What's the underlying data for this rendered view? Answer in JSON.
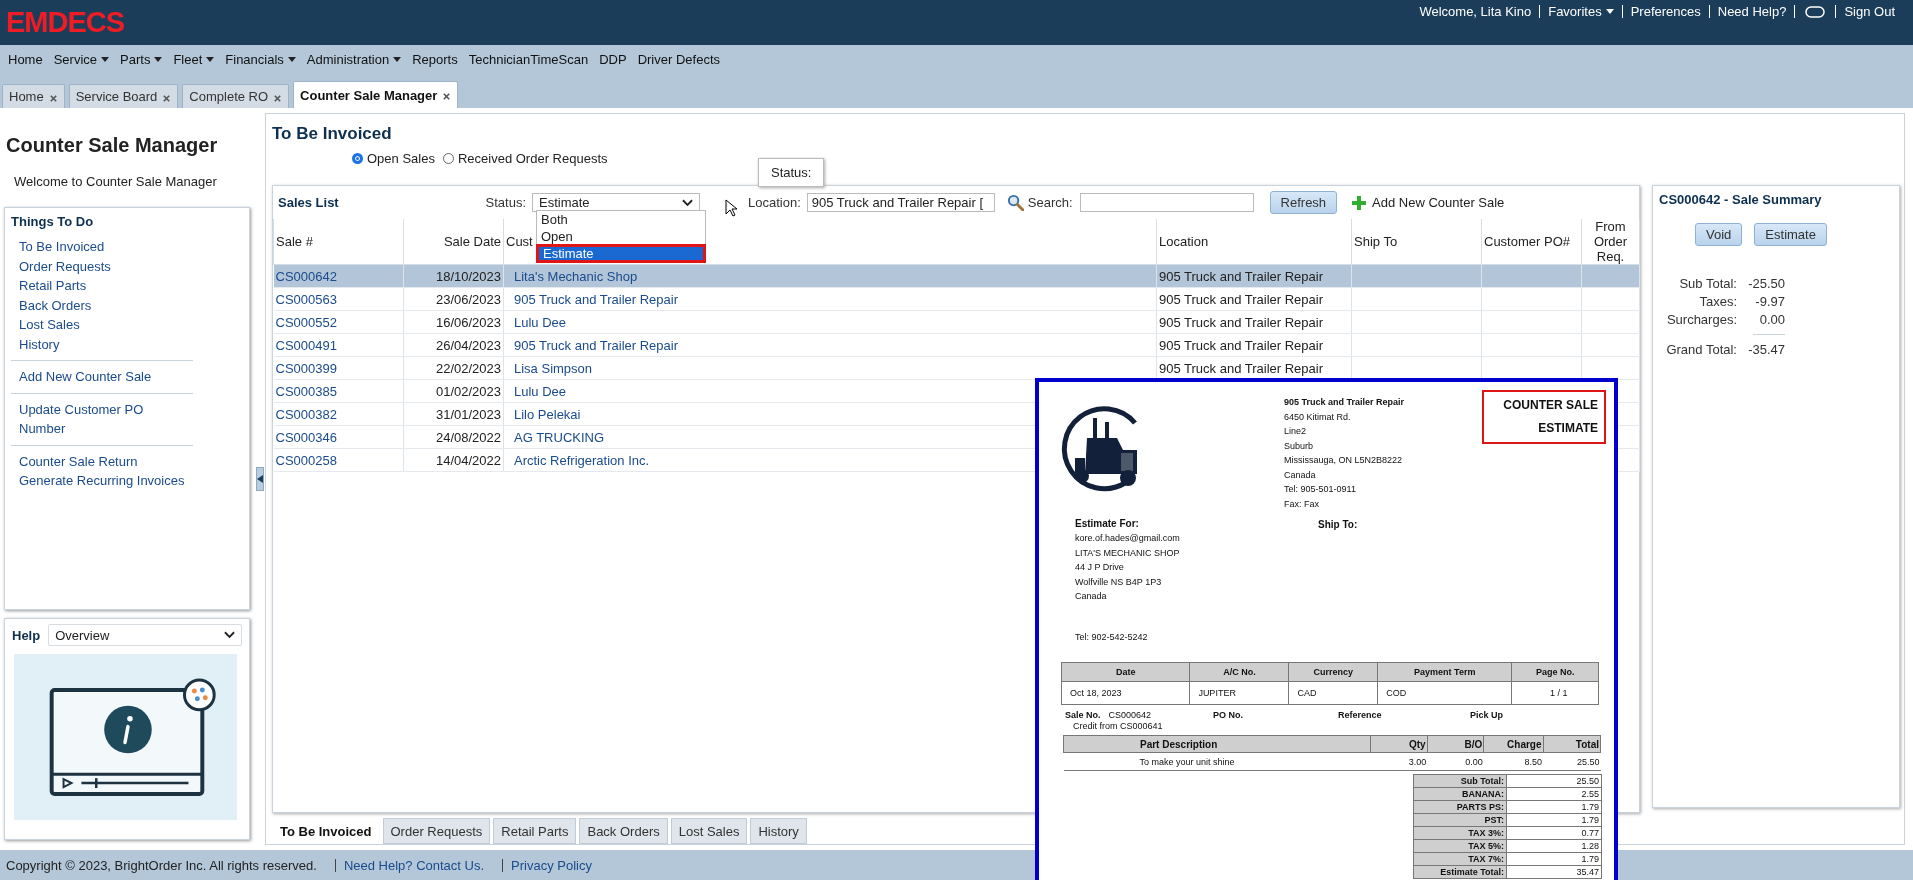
{
  "header": {
    "logo": "EMDECS",
    "links": [
      {
        "kind": "text",
        "label": "Welcome, Lita Kino"
      },
      {
        "kind": "menu",
        "label": "Favorites"
      },
      {
        "kind": "link",
        "label": "Preferences"
      },
      {
        "kind": "link",
        "label": "Need Help?"
      },
      {
        "kind": "icon"
      },
      {
        "kind": "link",
        "label": "Sign Out"
      }
    ]
  },
  "menu": [
    {
      "label": "Home",
      "has_menu": false
    },
    {
      "label": "Service",
      "has_menu": true
    },
    {
      "label": "Parts",
      "has_menu": true
    },
    {
      "label": "Fleet",
      "has_menu": true
    },
    {
      "label": "Financials",
      "has_menu": true
    },
    {
      "label": "Administration",
      "has_menu": true
    },
    {
      "label": "Reports",
      "has_menu": false
    },
    {
      "label": "TechnicianTimeScan",
      "has_menu": false
    },
    {
      "label": "DDP",
      "has_menu": false
    },
    {
      "label": "Driver Defects",
      "has_menu": false
    }
  ],
  "tabs": [
    {
      "label": "Home",
      "selected": false
    },
    {
      "label": "Service Board",
      "selected": false
    },
    {
      "label": "Complete RO",
      "selected": false
    },
    {
      "label": "Counter Sale Manager",
      "selected": true
    }
  ],
  "sidebar": {
    "title": "Counter Sale Manager",
    "welcome": "Welcome to Counter Sale Manager",
    "things_title": "Things To Do",
    "link_groups": [
      [
        "To Be Invoiced",
        "Order Requests",
        "Retail Parts",
        "Back Orders",
        "Lost Sales",
        "History"
      ],
      [
        "Add New Counter Sale"
      ],
      [
        "Update Customer PO Number"
      ],
      [
        "Counter Sale Return",
        "Generate Recurring Invoices"
      ]
    ],
    "help": {
      "label": "Help",
      "topic": "Overview"
    }
  },
  "main": {
    "title": "To Be Invoiced",
    "radios": [
      {
        "label": "Open Sales",
        "selected": true
      },
      {
        "label": "Received Order Requests",
        "selected": false
      }
    ],
    "sales_list": {
      "title": "Sales List",
      "status": {
        "label": "Status:",
        "value": "Estimate",
        "options": [
          {
            "label": "Both",
            "selected": false
          },
          {
            "label": "Open",
            "selected": false
          },
          {
            "label": "Estimate",
            "selected": true
          }
        ]
      },
      "tooltip": "Status:",
      "location": {
        "label": "Location:",
        "value": "905 Truck and Trailer Repair ["
      },
      "search": {
        "label": "Search:"
      },
      "refresh": "Refresh",
      "add_new": "Add New Counter Sale",
      "columns": [
        "Sale #",
        "Sale Date",
        "Cust",
        "Location",
        "Ship To",
        "Customer PO#",
        "From Order Req."
      ],
      "rows": [
        {
          "sale_no": "CS000642",
          "sale_date": "18/10/2023",
          "customer": "Lita's Mechanic Shop",
          "location": "905 Truck and Trailer Repair",
          "selected": true
        },
        {
          "sale_no": "CS000563",
          "sale_date": "23/06/2023",
          "customer": "905 Truck and Trailer Repair",
          "location": "905 Truck and Trailer Repair",
          "selected": false
        },
        {
          "sale_no": "CS000552",
          "sale_date": "16/06/2023",
          "customer": "Lulu Dee",
          "location": "905 Truck and Trailer Repair",
          "selected": false
        },
        {
          "sale_no": "CS000491",
          "sale_date": "26/04/2023",
          "customer": "905 Truck and Trailer Repair",
          "location": "905 Truck and Trailer Repair",
          "selected": false
        },
        {
          "sale_no": "CS000399",
          "sale_date": "22/02/2023",
          "customer": "Lisa Simpson",
          "location": "905 Truck and Trailer Repair",
          "selected": false
        },
        {
          "sale_no": "CS000385",
          "sale_date": "01/02/2023",
          "customer": "Lulu Dee",
          "selected": false
        },
        {
          "sale_no": "CS000382",
          "sale_date": "31/01/2023",
          "customer": "Lilo Pelekai",
          "selected": false
        },
        {
          "sale_no": "CS000346",
          "sale_date": "24/08/2022",
          "customer": "AG TRUCKING",
          "selected": false
        },
        {
          "sale_no": "CS000258",
          "sale_date": "14/04/2022",
          "customer": "Arctic Refrigeration Inc.",
          "selected": false
        }
      ]
    },
    "bottom_tabs": [
      {
        "label": "To Be Invoiced",
        "selected": true
      },
      {
        "label": "Order Requests",
        "selected": false
      },
      {
        "label": "Retail Parts",
        "selected": false
      },
      {
        "label": "Back Orders",
        "selected": false
      },
      {
        "label": "Lost Sales",
        "selected": false
      },
      {
        "label": "History",
        "selected": false
      }
    ]
  },
  "summary": {
    "title": "CS000642 - Sale Summary",
    "buttons": [
      "Void",
      "Estimate"
    ],
    "totals": [
      {
        "label": "Sub Total:",
        "value": "-25.50"
      },
      {
        "label": "Taxes:",
        "value": "-9.97"
      },
      {
        "label": "Surcharges:",
        "value": "0.00"
      }
    ],
    "grand_total": {
      "label": "Grand Total:",
      "value": "-35.47"
    }
  },
  "invoice": {
    "company_name": "905 Truck and Trailer Repair",
    "company_lines": [
      "6450 Kitimat Rd.",
      "Line2",
      "Suburb",
      "Mississauga, ON L5N2B8222",
      "Canada",
      "Tel: 905-501-0911",
      "Fax: Fax"
    ],
    "title_lines": [
      "COUNTER SALE",
      "ESTIMATE"
    ],
    "estimate_for": "Estimate For:",
    "customer_lines": [
      "kore.of.hades@gmail.com",
      "LITA'S MECHANIC SHOP",
      "44 J P Drive",
      "Wolfville NS   B4P 1P3",
      "Canada"
    ],
    "customer_tel": "Tel: 902-542-5242",
    "ship_to": "Ship To:",
    "info_columns": [
      "Date",
      "A/C No.",
      "Currency",
      "Payment Term",
      "Page No."
    ],
    "info_values": [
      "Oct 18, 2023",
      "JUPITER",
      "CAD",
      "COD",
      "1 / 1"
    ],
    "refs": [
      {
        "label": "Sale No.",
        "value": "CS000642"
      },
      {
        "label": "PO No."
      },
      {
        "label": "Reference"
      },
      {
        "label": "Pick Up"
      }
    ],
    "credit_note": "Credit from CS000641",
    "part_columns": [
      "Part Description",
      "Qty",
      "B/O",
      "Charge",
      "Total"
    ],
    "part_rows": [
      [
        "To make your unit shine",
        "3.00",
        "0.00",
        "8.50",
        "25.50"
      ]
    ],
    "totals": [
      {
        "label": "Sub Total:",
        "value": "25.50"
      },
      {
        "label": "BANANA:",
        "value": "2.55"
      },
      {
        "label": "PARTS PS:",
        "value": "1.79"
      },
      {
        "label": "PST:",
        "value": "1.79"
      },
      {
        "label": "TAX 3%:",
        "value": "0.77"
      },
      {
        "label": "TAX 5%:",
        "value": "1.28"
      },
      {
        "label": "TAX 7%:",
        "value": "1.79"
      },
      {
        "label": "Estimate Total:",
        "value": "35.47"
      }
    ]
  },
  "footer": {
    "copyright": "Copyright © 2023, BrightOrder Inc. All rights reserved.",
    "links": [
      "Need Help? Contact Us.",
      "Privacy Policy"
    ]
  }
}
